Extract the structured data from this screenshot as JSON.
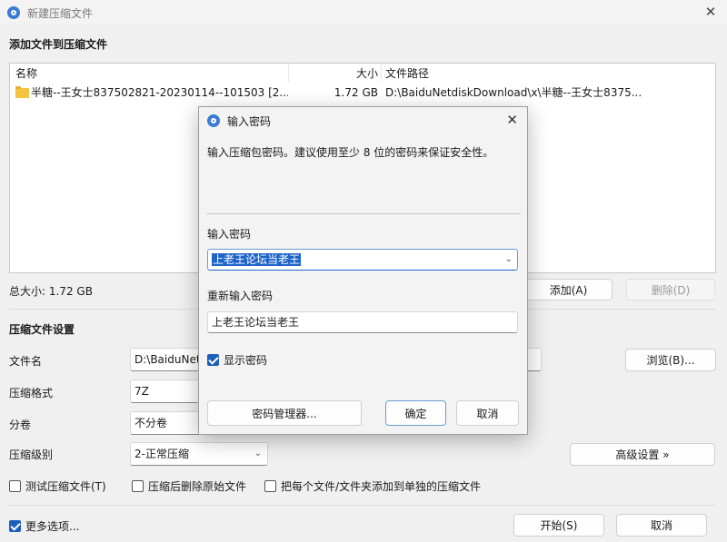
{
  "window": {
    "title": "新建压缩文件"
  },
  "files": {
    "section_label": "添加文件到压缩文件",
    "columns": {
      "name": "名称",
      "size": "大小",
      "path": "文件路径"
    },
    "rows": [
      {
        "name": "半糖--王女士837502821-20230114--101503 [2...",
        "size": "1.72 GB",
        "path": "D:\\BaiduNetdiskDownload\\x\\半糖--王女士8375..."
      }
    ],
    "total": "总大小: 1.72 GB",
    "add_label": "添加(A)",
    "delete_label": "删除(D)"
  },
  "settings": {
    "section_label": "压缩文件设置",
    "filename_label": "文件名",
    "filename_value": "D:\\BaiduNet",
    "browse_label": "浏览(B)...",
    "format_label": "压缩格式",
    "format_value": "7Z",
    "volume_label": "分卷",
    "volume_value": "不分卷",
    "level_label": "压缩级别",
    "level_value": "2-正常压缩",
    "advanced_label": "高级设置 »",
    "opt_test": "测试压缩文件(T)",
    "opt_delete": "压缩后删除原始文件",
    "opt_each": "把每个文件/文件夹添加到单独的压缩文件",
    "more_options": "更多选项...",
    "start_label": "开始(S)",
    "cancel_label": "取消"
  },
  "dialog": {
    "title": "输入密码",
    "description": "输入压缩包密码。建议使用至少 8 位的密码来保证安全性。",
    "password_label": "输入密码",
    "password_value": "上老王论坛当老王",
    "reenter_label": "重新输入密码",
    "reenter_value": "上老王论坛当老王",
    "show_password_label": "显示密码",
    "manager_label": "密码管理器...",
    "ok_label": "确定",
    "cancel_label": "取消"
  }
}
